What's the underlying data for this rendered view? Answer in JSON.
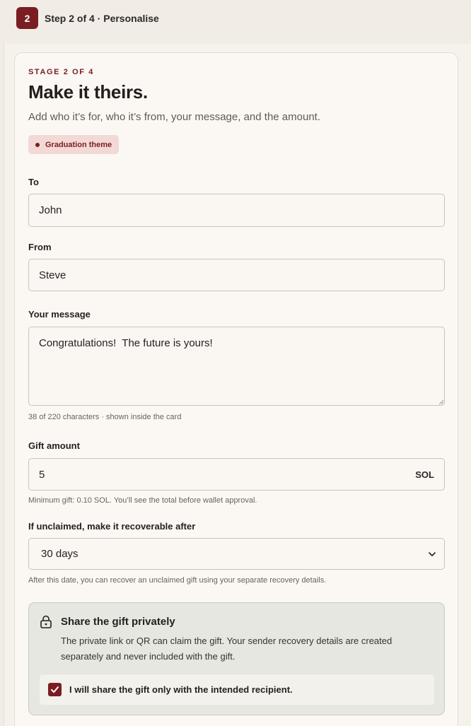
{
  "step": {
    "number": "2",
    "label": "Step 2 of 4 · Personalise"
  },
  "card": {
    "eyebrow": "STAGE 2 OF 4",
    "title": "Make it theirs.",
    "subtitle": "Add who it’s for, who it’s from, your message, and the amount.",
    "theme_chip": "Graduation theme"
  },
  "fields": {
    "to": {
      "label": "To",
      "value": "John"
    },
    "from": {
      "label": "From",
      "value": "Steve"
    },
    "message": {
      "label": "Your message",
      "value": "Congratulations!  The future is yours!",
      "helper": "38 of 220 characters · shown inside the card"
    },
    "amount": {
      "label": "Gift amount",
      "value": "5",
      "unit": "SOL",
      "helper": "Minimum gift: 0.10 SOL. You’ll see the total before wallet approval."
    },
    "recovery": {
      "label": "If unclaimed, make it recoverable after",
      "selected": "30 days",
      "helper": "After this date, you can recover an unclaimed gift using your separate recovery details."
    }
  },
  "privacy": {
    "icon": "lock-icon",
    "title": "Share the gift privately",
    "body": "The private link or QR can claim the gift. Your sender recovery details are created separately and never included with the gift.",
    "confirm_label": "I will share the gift only with the intended recipient.",
    "confirm_checked": true
  },
  "colors": {
    "accent": "#7a1d22",
    "chip_bg": "#f2d9d5",
    "privacy_bg": "#e6e7e1"
  }
}
